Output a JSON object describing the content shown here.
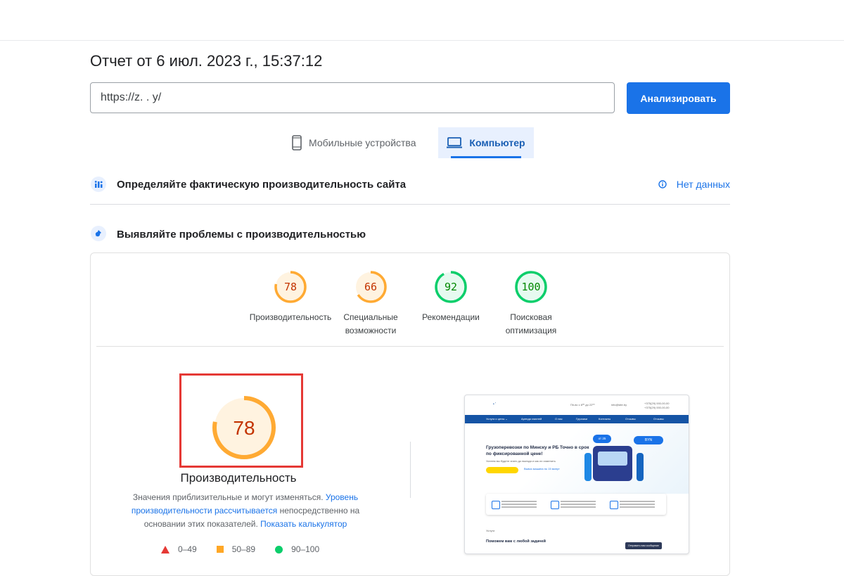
{
  "report": {
    "title": "Отчет от 6 июл. 2023 г., 15:37:12"
  },
  "url_input": {
    "value": "https://z.    .   y/"
  },
  "analyze_button": {
    "label": "Анализировать"
  },
  "tabs": [
    {
      "label": "Мобильные устройства",
      "icon": "smartphone-icon",
      "selected": false
    },
    {
      "label": "Компьютер",
      "icon": "laptop-icon",
      "selected": true
    }
  ],
  "field_data": {
    "title": "Определяйте фактическую производительность сайта",
    "status": "Нет данных",
    "icon": "crux-data-icon",
    "status_icon": "info-icon"
  },
  "lab_data": {
    "title": "Выявляйте проблемы с производительностью",
    "icon": "lighthouse-icon"
  },
  "scores": [
    {
      "value": 78,
      "label": "Производительность",
      "color": "#fa3",
      "text_color": "#c33300"
    },
    {
      "value": 66,
      "label": "Специальные возможности",
      "color": "#fa3",
      "text_color": "#c33300"
    },
    {
      "value": 92,
      "label": "Рекомендации",
      "color": "#0cce6b",
      "text_color": "#008800"
    },
    {
      "value": 100,
      "label": "Поисковая оптимизация",
      "color": "#0cce6b",
      "text_color": "#008800"
    }
  ],
  "main_score": {
    "value": 78,
    "label": "Производительность"
  },
  "description": {
    "text1": "Значения приблизительные и могут изменяться. ",
    "link1": "Уровень производительности рассчитывается",
    "text2": " непосредственно на основании этих показателей. ",
    "link2": "Показать калькулятор"
  },
  "legend": [
    {
      "range": "0–49",
      "shape": "triangle",
      "color": "#e53935"
    },
    {
      "range": "50–89",
      "shape": "square",
      "color": "#ffa726"
    },
    {
      "range": "90–100",
      "shape": "circle",
      "color": "#0cce6b"
    }
  ],
  "preview": {
    "headline": "Грузоперевозки по Минску и РБ Точно в срок по фиксированной цене!",
    "section_title": "Поможем вам с любой задачей",
    "badge_price": "от 25",
    "badge_currency": "BYN"
  }
}
